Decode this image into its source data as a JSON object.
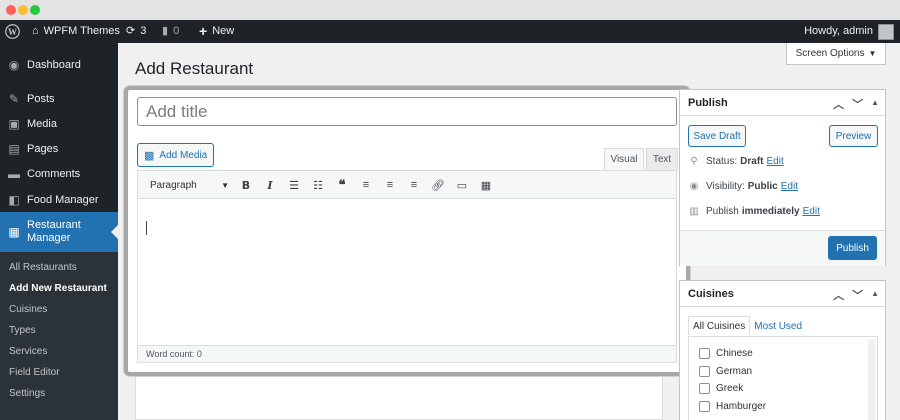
{
  "admin_bar": {
    "site_name": "WPFM Themes",
    "updates_count": "3",
    "comments_count": "0",
    "new_label": "New",
    "howdy": "Howdy, admin"
  },
  "sidebar": {
    "items": [
      {
        "label": "Dashboard",
        "icon": "dashboard-icon"
      },
      {
        "label": "Posts",
        "icon": "pin-icon"
      },
      {
        "label": "Media",
        "icon": "media-icon"
      },
      {
        "label": "Pages",
        "icon": "pages-icon"
      },
      {
        "label": "Comments",
        "icon": "comment-icon"
      },
      {
        "label": "Food Manager",
        "icon": "food-manager-icon"
      },
      {
        "label": "Restaurant Manager",
        "icon": "restaurant-icon",
        "current": true
      }
    ],
    "submenu": [
      {
        "label": "All Restaurants"
      },
      {
        "label": "Add New Restaurant",
        "active": true
      },
      {
        "label": "Cuisines"
      },
      {
        "label": "Types"
      },
      {
        "label": "Services"
      },
      {
        "label": "Field Editor"
      },
      {
        "label": "Settings"
      }
    ]
  },
  "screen_options": "Screen Options",
  "page_title": "Add Restaurant",
  "editor": {
    "title_placeholder": "Add title",
    "add_media": "Add Media",
    "tab_visual": "Visual",
    "tab_text": "Text",
    "format_select": "Paragraph",
    "toolbar": [
      "bold-icon",
      "italic-icon",
      "bullet-list-icon",
      "numbered-list-icon",
      "blockquote-icon",
      "align-left-icon",
      "align-center-icon",
      "align-right-icon",
      "link-icon",
      "read-more-icon",
      "toolbar-toggle-icon"
    ],
    "word_count": "Word count: 0"
  },
  "publish": {
    "title": "Publish",
    "save_draft": "Save Draft",
    "preview": "Preview",
    "status_label": "Status:",
    "status_value": "Draft",
    "visibility_label": "Visibility:",
    "visibility_value": "Public",
    "publish_label": "Publish",
    "publish_value": "immediately",
    "edit": "Edit",
    "publish_button": "Publish"
  },
  "cuisines": {
    "title": "Cuisines",
    "tab_all": "All Cuisines",
    "tab_most_used": "Most Used",
    "items": [
      "Chinese",
      "German",
      "Greek",
      "Hamburger"
    ]
  },
  "colors": {
    "admin_bar": "#1d2327",
    "accent": "#2271b1"
  }
}
